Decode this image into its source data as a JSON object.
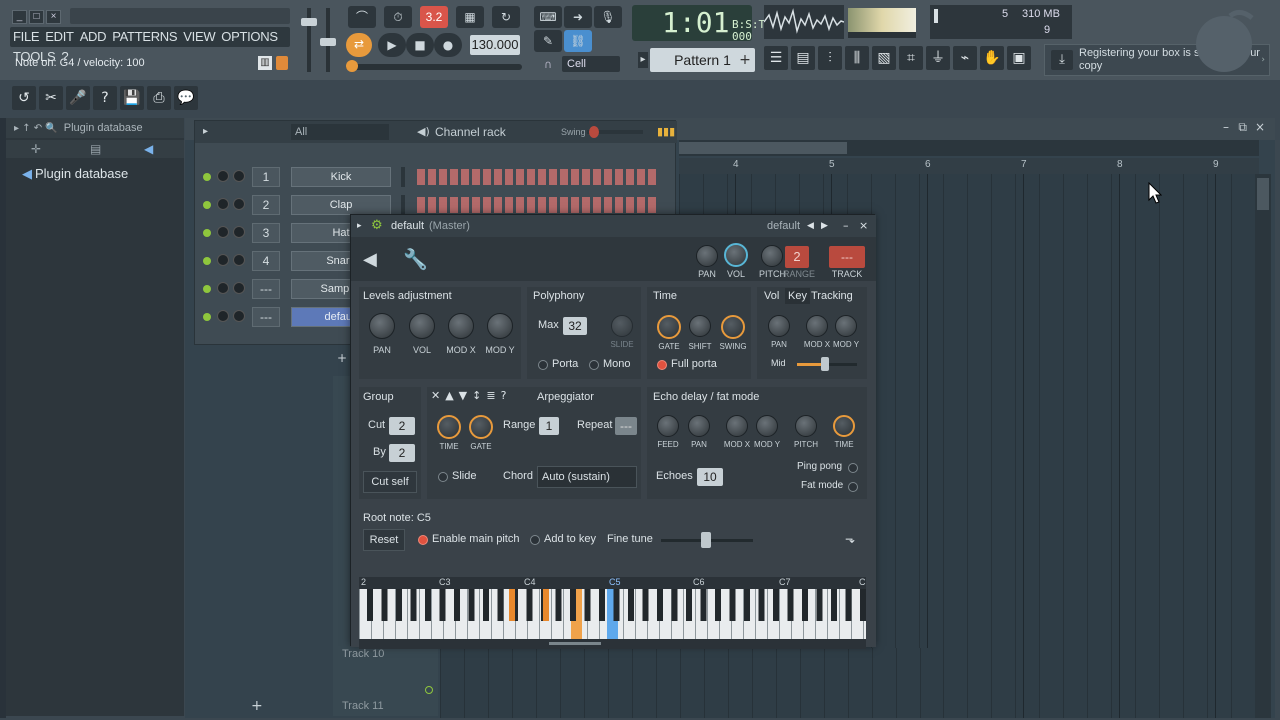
{
  "menu": [
    "FILE",
    "EDIT",
    "ADD",
    "PATTERNS",
    "VIEW",
    "OPTIONS",
    "TOOLS",
    "?"
  ],
  "hint": "Note on: G4 / velocity: 100",
  "transport": {
    "bpm": "130.000",
    "time": "1:01",
    "time_small": "000",
    "bst": "B:S:T",
    "pattern": "Pattern 1",
    "snap": "Cell",
    "tempo_badge": "3.2"
  },
  "cpu": {
    "cpu_num": "5",
    "mem": "310 MB",
    "poly": "9"
  },
  "news": "Registering your box is securing your copy",
  "browser": {
    "header": "Plugin database",
    "item": "Plugin database"
  },
  "channel_rack": {
    "filter": "All",
    "title": "Channel rack",
    "swing": "Swing",
    "channels": [
      {
        "num": "1",
        "name": "Kick"
      },
      {
        "num": "2",
        "name": "Clap"
      },
      {
        "num": "3",
        "name": "Hat"
      },
      {
        "num": "4",
        "name": "Snare"
      },
      {
        "num": "---",
        "name": "Sampler"
      },
      {
        "num": "---",
        "name": "default"
      }
    ]
  },
  "playlist": {
    "bars": [
      "4",
      "5",
      "6",
      "7",
      "8",
      "9"
    ],
    "tracks": [
      "Track 10",
      "Track 11"
    ]
  },
  "settings": {
    "title": "default",
    "title_suffix": "(Master)",
    "preset": "default",
    "head_knobs": [
      "PAN",
      "VOL",
      "PITCH",
      "RANGE",
      "TRACK"
    ],
    "range_val": "2",
    "track_val": "---",
    "levels": {
      "title": "Levels adjustment",
      "knobs": [
        "PAN",
        "VOL",
        "MOD X",
        "MOD Y"
      ]
    },
    "polyphony": {
      "title": "Polyphony",
      "max_label": "Max",
      "max_val": "32",
      "slide": "SLIDE",
      "porta": "Porta",
      "mono": "Mono"
    },
    "time": {
      "title": "Time",
      "knobs": [
        "GATE",
        "SHIFT",
        "SWING"
      ],
      "full_porta": "Full porta"
    },
    "tracking": {
      "tabs": [
        "Vol",
        "Key",
        "Tracking"
      ],
      "knobs": [
        "PAN",
        "MOD X",
        "MOD Y"
      ],
      "mid": "Mid"
    },
    "group": {
      "title": "Group",
      "cut": "Cut",
      "cut_val": "2",
      "by": "By",
      "by_val": "2",
      "cut_self": "Cut self"
    },
    "arp": {
      "title": "Arpeggiator",
      "knobs": [
        "TIME",
        "GATE"
      ],
      "range": "Range",
      "range_val": "1",
      "repeat": "Repeat",
      "repeat_val": "---",
      "slide": "Slide",
      "chord": "Chord",
      "chord_val": "Auto (sustain)"
    },
    "echo": {
      "title": "Echo delay / fat mode",
      "knobs": [
        "FEED",
        "PAN",
        "MOD X",
        "MOD Y",
        "PITCH",
        "TIME"
      ],
      "echoes": "Echoes",
      "echoes_val": "10",
      "ping_pong": "Ping pong",
      "fat_mode": "Fat mode"
    },
    "root": {
      "label": "Root note: C5",
      "reset": "Reset",
      "enable_pitch": "Enable main pitch",
      "add_key": "Add to key",
      "fine_tune": "Fine tune"
    },
    "octaves": [
      "2",
      "C3",
      "C4",
      "C5",
      "C6",
      "C7",
      "C"
    ]
  }
}
